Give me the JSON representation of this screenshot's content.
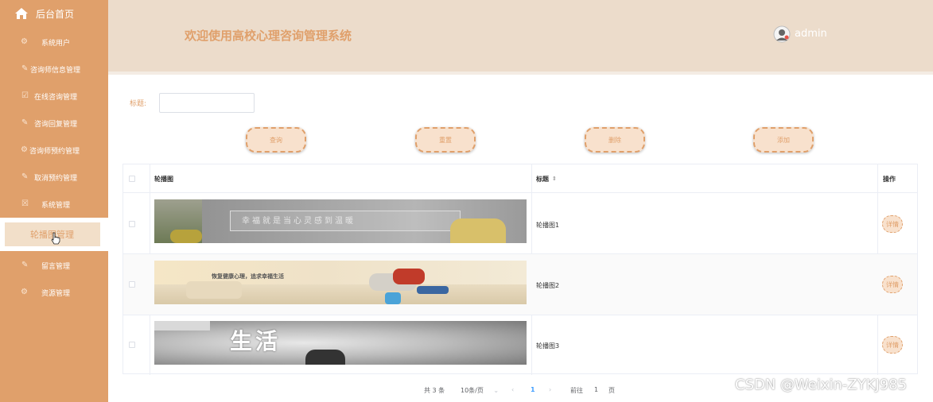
{
  "sidebar": {
    "home_label": "后台首页",
    "items": [
      {
        "label": "系统用户",
        "icon": "gear-icon"
      },
      {
        "label": "咨询师信息管理",
        "icon": "edit-icon"
      },
      {
        "label": "在线咨询管理",
        "icon": "check-icon"
      },
      {
        "label": "咨询回复管理",
        "icon": "edit-icon"
      },
      {
        "label": "咨询师预约管理",
        "icon": "gear-icon"
      },
      {
        "label": "取消预约管理",
        "icon": "edit-icon"
      },
      {
        "label": "系统管理",
        "icon": "close-icon"
      },
      {
        "label": "轮播图管理",
        "icon": "image-icon",
        "active": true
      },
      {
        "label": "留言管理",
        "icon": "edit-icon"
      },
      {
        "label": "资源管理",
        "icon": "gear-icon"
      }
    ]
  },
  "header": {
    "title": "欢迎使用高校心理咨询管理系统",
    "username": "admin"
  },
  "search": {
    "label": "标题:",
    "value": ""
  },
  "buttons": {
    "query": "查询",
    "reset": "重置",
    "delete": "删除",
    "add": "添加"
  },
  "table": {
    "columns": {
      "image": "轮播图",
      "title": "标题",
      "actions": "操作"
    },
    "rows": [
      {
        "title": "轮播图1",
        "banner_text": "幸福就是当心灵感到温暖"
      },
      {
        "title": "轮播图2",
        "banner_text": "恢复健康心理，追求幸福生活"
      },
      {
        "title": "轮播图3",
        "banner_text": "生活"
      }
    ],
    "detail_label": "详情"
  },
  "pager": {
    "total": "共 3 条",
    "page_size": "10条/页",
    "current": "1",
    "goto_prefix": "前往",
    "goto_value": "1",
    "goto_suffix": "页"
  },
  "watermark": "CSDN @Weixin-ZYKJ985",
  "colors": {
    "accent": "#e0a06b",
    "header_bg": "#ecdccb",
    "button_bg": "#f8e1cd"
  }
}
